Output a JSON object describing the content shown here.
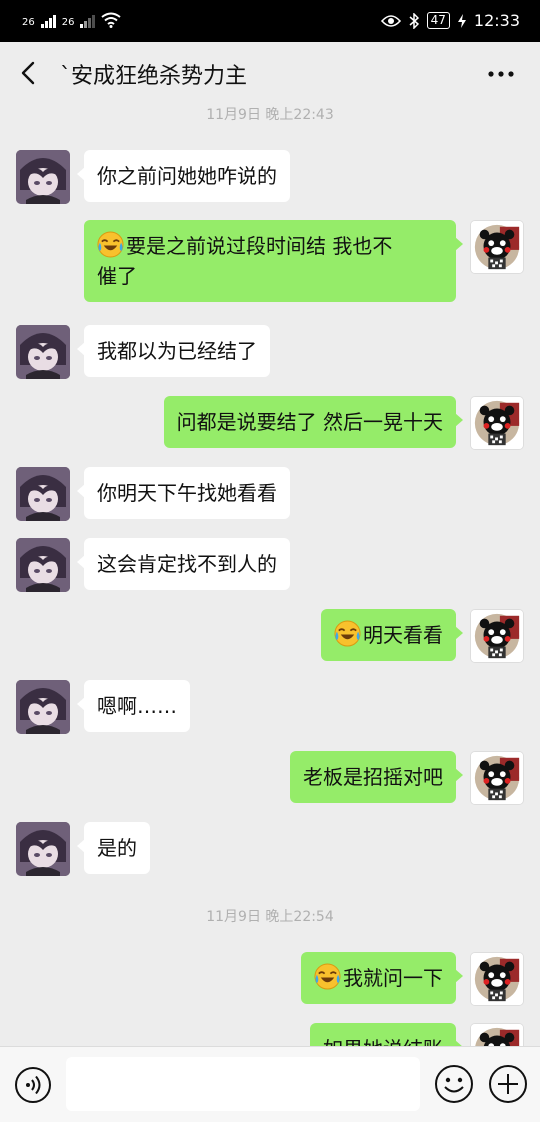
{
  "status_bar": {
    "sim1_label": "26",
    "sim2_label": "26",
    "battery": "47",
    "time": "12:33"
  },
  "header": {
    "title": "ˋ安成狂绝杀势力主"
  },
  "input_bar": {
    "placeholder": ""
  },
  "messages": [
    {
      "type": "time",
      "text": "11月9日 晚上22:43"
    },
    {
      "type": "left",
      "text": "你之前问她她咋说的"
    },
    {
      "type": "right",
      "emoji": "laugh-cry-emoji",
      "line1": "要是之前说过段时间结  我也不",
      "line2": "催了"
    },
    {
      "type": "left",
      "text": "我都以为已经结了"
    },
    {
      "type": "right",
      "text": "问都是说要结了 然后一晃十天"
    },
    {
      "type": "left",
      "text": "你明天下午找她看看"
    },
    {
      "type": "left",
      "text": "这会肯定找不到人的"
    },
    {
      "type": "right",
      "emoji": "laugh-cry-emoji",
      "text": "明天看看"
    },
    {
      "type": "left",
      "text": "嗯啊……"
    },
    {
      "type": "right",
      "text": "老板是招摇对吧"
    },
    {
      "type": "left",
      "text": "是的"
    },
    {
      "type": "time",
      "text": "11月9日 晚上22:54"
    },
    {
      "type": "right",
      "emoji": "laugh-cry-emoji",
      "text": "我就问一下"
    },
    {
      "type": "right",
      "text": "如果她说结账"
    }
  ]
}
